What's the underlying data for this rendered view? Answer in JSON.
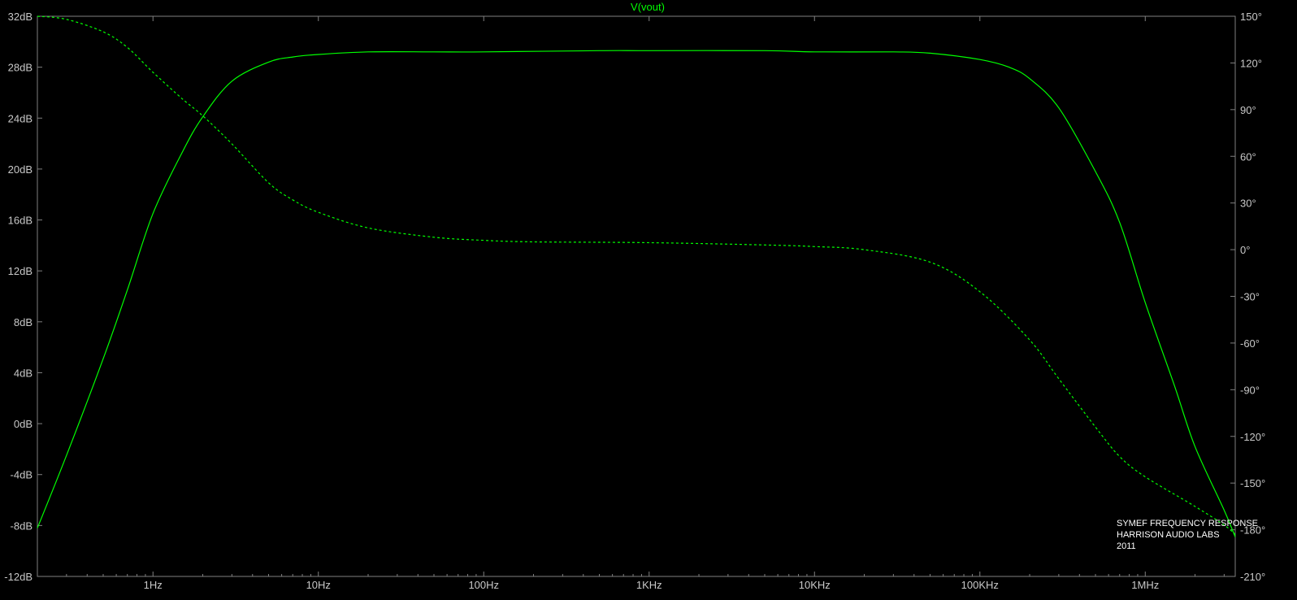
{
  "chart_data": {
    "type": "line",
    "title": "V(vout)",
    "x_scale": "log",
    "xlim": [
      0.2,
      3500000
    ],
    "ylim_left": [
      -12,
      32
    ],
    "ylim_right": [
      -210,
      150
    ],
    "x_tick_labels": [
      "1Hz",
      "10Hz",
      "100Hz",
      "1KHz",
      "10KHz",
      "100KHz",
      "1MHz"
    ],
    "x_tick_values": [
      1,
      10,
      100,
      1000,
      10000,
      100000,
      1000000
    ],
    "y_left_tick_labels": [
      "32dB",
      "28dB",
      "24dB",
      "20dB",
      "16dB",
      "12dB",
      "8dB",
      "4dB",
      "0dB",
      "-4dB",
      "-8dB",
      "-12dB"
    ],
    "y_left_tick_values": [
      32,
      28,
      24,
      20,
      16,
      12,
      8,
      4,
      0,
      -4,
      -8,
      -12
    ],
    "y_right_tick_labels": [
      "150°",
      "120°",
      "90°",
      "60°",
      "30°",
      "0°",
      "-30°",
      "-60°",
      "-90°",
      "-120°",
      "-150°",
      "-180°",
      "-210°"
    ],
    "y_right_tick_values": [
      150,
      120,
      90,
      60,
      30,
      0,
      -30,
      -60,
      -90,
      -120,
      -150,
      -180,
      -210
    ],
    "grid": false,
    "annotation": [
      "SYMEF FREQUENCY RESPONSE",
      "HARRISON AUDIO LABS",
      "2011"
    ],
    "colors": {
      "background": "#000000",
      "trace": "#00ff00",
      "axis": "#808080",
      "tick_text": "#c8c8c8",
      "annotation": "#ffffff"
    },
    "series": [
      {
        "axis": "left",
        "style": "solid",
        "x": [
          0.2,
          0.3,
          0.5,
          0.7,
          1,
          1.5,
          2,
          3,
          5,
          7,
          10,
          20,
          50,
          100,
          500,
          1000,
          5000,
          10000,
          30000,
          50000,
          100000,
          150000,
          200000,
          300000,
          500000,
          700000,
          1000000,
          1500000,
          2000000,
          3000000,
          3500000
        ],
        "values": [
          -8.2,
          -2.5,
          5.1,
          10.5,
          16.5,
          21.3,
          24.1,
          26.9,
          28.4,
          28.8,
          29.0,
          29.2,
          29.2,
          29.2,
          29.3,
          29.3,
          29.3,
          29.2,
          29.2,
          29.1,
          28.6,
          28.0,
          27.1,
          24.8,
          19.8,
          15.8,
          9.5,
          3.0,
          -1.8,
          -6.8,
          -8.9
        ]
      },
      {
        "axis": "right",
        "style": "dashed",
        "x": [
          0.2,
          0.3,
          0.5,
          0.7,
          1,
          1.5,
          2,
          3,
          5,
          7,
          10,
          20,
          50,
          100,
          200,
          1000,
          5000,
          10000,
          20000,
          50000,
          100000,
          200000,
          300000,
          500000,
          700000,
          1000000,
          2000000,
          3000000,
          3500000
        ],
        "values": [
          150,
          148,
          140,
          130,
          114,
          97,
          86,
          68,
          43,
          32,
          24,
          14,
          8,
          6,
          5,
          4.5,
          3,
          2,
          0,
          -8,
          -27,
          -58,
          -83,
          -114,
          -133,
          -146,
          -165,
          -177,
          -183
        ]
      }
    ]
  }
}
